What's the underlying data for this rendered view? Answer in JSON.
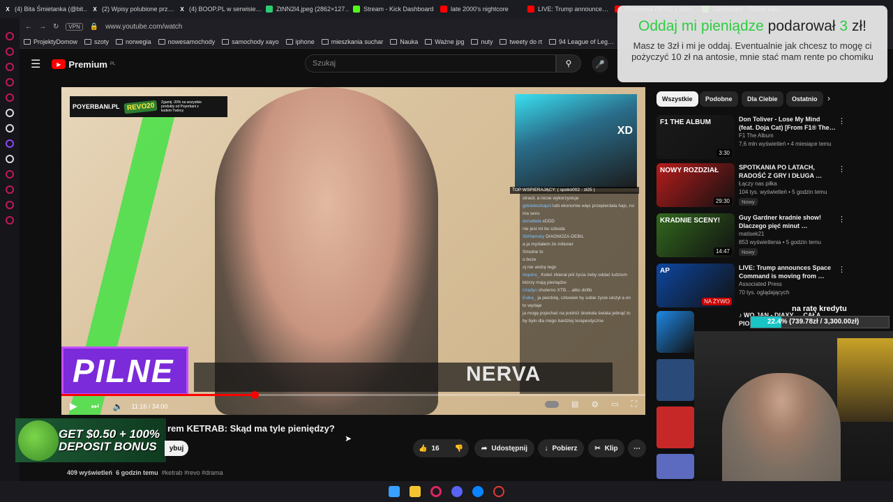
{
  "tabs": [
    {
      "label": "(4) Bita Śmietanka (@bit…",
      "icon": "x-icon",
      "color": "#ffffff"
    },
    {
      "label": "(2) Wpisy polubione prz…",
      "icon": "x-icon",
      "color": "#ffffff"
    },
    {
      "label": "(4) BOOP.PL w serwisie…",
      "icon": "x-icon",
      "color": "#ffffff"
    },
    {
      "label": "ZtNN2l4.jpeg (2862×127…",
      "icon": "image-icon",
      "color": "#2ecc71"
    },
    {
      "label": "Stream - Kick Dashboard",
      "icon": "kick-icon",
      "color": "#53fc18"
    },
    {
      "label": "late 2000's nightcore",
      "icon": "youtube-icon",
      "color": "#ff0000"
    },
    {
      "label": "LIVE: Trump announce…",
      "icon": "youtube-icon",
      "color": "#ff0000"
    },
    {
      "label": "Rozmowa REVO z dam…",
      "icon": "youtube-icon",
      "color": "#ff0000"
    },
    {
      "label": "Dashboard - Widok kan…",
      "icon": "kick-icon",
      "color": "#53fc18"
    }
  ],
  "address": {
    "vpn": "VPN",
    "url": "www.youtube.com/watch"
  },
  "bookmarks": [
    "ProjektyDomow",
    "szoty",
    "norwegia",
    "nowesamochody",
    "samochody xayo",
    "iphone",
    "mieszkania suchar",
    "Nauka",
    "Ważne jpg",
    "nuty",
    "tweety do rt",
    "94 League of Leg…"
  ],
  "youtube": {
    "logo": "Premium",
    "logo_region": "PL",
    "search_placeholder": "Szukaj"
  },
  "player": {
    "promo_brand": "POYERBANI.PL",
    "promo_code": "REVO20",
    "promo_note": "Zgarnij -20% na wszystkie produkty od Poyerbani z kodem Twórcy",
    "webcam_tag": "XD",
    "top_supporter": "TOP WSPIERAJĄCY: ( spoko002 · zł25 )",
    "chat": [
      {
        "user": "",
        "text": "stracił, a nicoe wykorzystuje"
      },
      {
        "user": "gdziebezkapci",
        "text": "lubi ekonomie więc przepierdala hajs, no ma sens"
      },
      {
        "user": "donattela",
        "text": "xDDD"
      },
      {
        "user": "",
        "text": "nie jest mi bo szkoda"
      },
      {
        "user": "SirHamsky",
        "text": "DIAGNOZA-DEBIL"
      },
      {
        "user": "",
        "text": "a ja myślałem że milioner"
      },
      {
        "user": "",
        "text": "Smutne to"
      },
      {
        "user": "",
        "text": "o boze"
      },
      {
        "user": "",
        "text": "oj nie widzę tego"
      },
      {
        "user": "Inquins_",
        "text": "Koleś zbierał pół życia żeby oddać ludziom którzy mają pieniądze"
      },
      {
        "user": "Uradyn",
        "text": "cholerno XTB… albo dzifki"
      },
      {
        "user": "Ewka_",
        "text": "ja pierdolę, człowiek by sobie życie ułożył a on to wydaje"
      },
      {
        "user": "",
        "text": "ja mogę pojechać na podróż dookoła świata jebnąć to by było dla niego bardziej terapeutyczne"
      }
    ],
    "lower_third": "PILNE",
    "nerva": "NERVA",
    "time": "11:16 / 34:00",
    "progress": 0.331
  },
  "video": {
    "title": "rem KETRAB: Skąd ma tyle pieniędzy?",
    "subscribe": "ybuj",
    "likes": "16",
    "share": "Udostępnij",
    "download": "Pobierz",
    "clip": "Klip",
    "views": "409 wyświetleń",
    "age": "6 godzin temu",
    "tags": "#ketrab #revo #drama"
  },
  "casino_ad": {
    "line1": "GET $0.50 + 100%",
    "line2": "DEPOSIT BONUS"
  },
  "chips": [
    {
      "label": "Wszystkie",
      "active": true
    },
    {
      "label": "Podobne",
      "active": false
    },
    {
      "label": "Dla Ciebie",
      "active": false
    },
    {
      "label": "Ostatnio",
      "active": false
    }
  ],
  "recommendations": [
    {
      "title": "Don Toliver - Lose My Mind (feat. Doja Cat) [From F1® The…",
      "channel": "F1 The Album",
      "meta": "7,6 mln wyświetleń • 4 miesiące temu",
      "duration": "3:30",
      "new": "",
      "thumb_text": "F1 THE ALBUM",
      "color": "#1a1a1a"
    },
    {
      "title": "SPOTKANIA PO LATACH, RADOŚĆ Z GRY I DŁUGA …",
      "channel": "Łączy nas piłka",
      "meta": "104 tys. wyświetleń • 5 godzin temu",
      "duration": "29:30",
      "new": "Nowy",
      "thumb_text": "NOWY ROZDZIAŁ",
      "color": "#b71c1c"
    },
    {
      "title": "Guy Gardner kradnie show! Dlaczego pięć minut …",
      "channel": "matisek21",
      "meta": "853 wyświetlenia • 5 godzin temu",
      "duration": "14:47",
      "new": "Nowy",
      "thumb_text": "KRADNIE SCENY!",
      "color": "#33691e"
    },
    {
      "title": "LIVE: Trump announces Space Command is moving from …",
      "channel": "Associated Press",
      "meta": "70 tys. oglądających",
      "duration": "NA ŻYWO",
      "new": "",
      "thumb_text": "AP",
      "color": "#0d47a1"
    },
    {
      "title": "♪ WO JAN - DIAXY … CAŁA PIOS…",
      "channel": "",
      "meta": "",
      "duration": "",
      "new": "",
      "thumb_text": "",
      "color": "#1e88e5"
    }
  ],
  "donation": {
    "name": "Oddaj mi pieniądze",
    "verb": "podarował",
    "amount": "3",
    "currency": "zł!",
    "message": "Masz te 3zł i mi je oddaj. Eventualnie jak chcesz to mogę ci pożyczyć 10 zł na antosie, mnie stać mam rente po chomiku"
  },
  "goal": {
    "title": "na ratę kredytu",
    "text": "22.4% (739.78zł / 3,300.00zł)",
    "fraction": 0.224
  },
  "colors": {
    "accent": "#ff0000",
    "donation_green": "#2ecc40",
    "goal_fill": "#18c4c4",
    "pilne_purple": "#7b2bd9"
  }
}
